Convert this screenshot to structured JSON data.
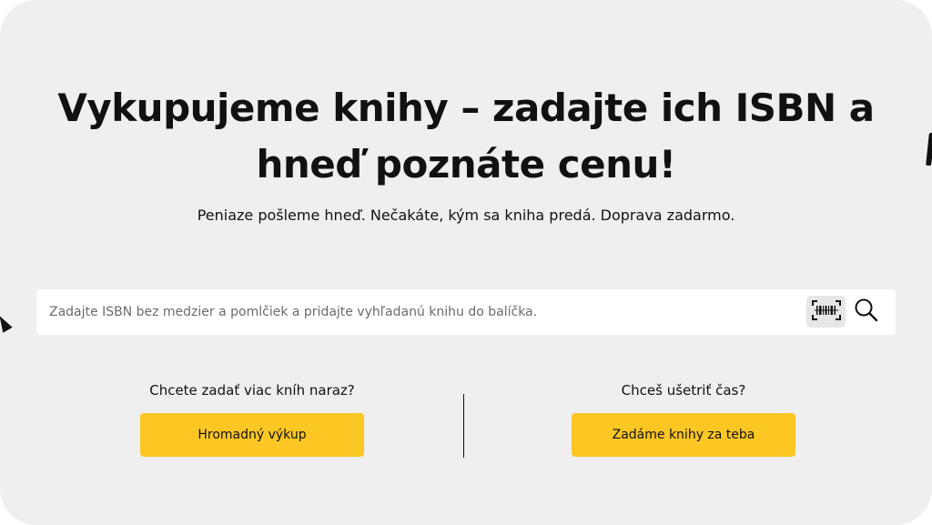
{
  "hero": {
    "title": "Vykupujeme knihy – zadajte ich ISBN a hneď poznáte cenu!",
    "subtitle": "Peniaze pošleme hneď. Nečakáte, kým sa kniha predá. Doprava zadarmo."
  },
  "search": {
    "placeholder": "Zadajte ISBN bez medzier a pomlčiek a pridajte vyhľadanú knihu do balíčka.",
    "value": "",
    "barcode_icon": "barcode-scan-icon",
    "search_icon": "magnifier-icon"
  },
  "options": {
    "bulk": {
      "question": "Chcete zadať viac kníh naraz?",
      "button_label": "Hromadný výkup"
    },
    "service": {
      "question": "Chceš ušetriť čas?",
      "button_label": "Zadáme knihy za teba"
    }
  },
  "colors": {
    "background": "#efefef",
    "accent": "#fcc623",
    "text": "#111111"
  }
}
